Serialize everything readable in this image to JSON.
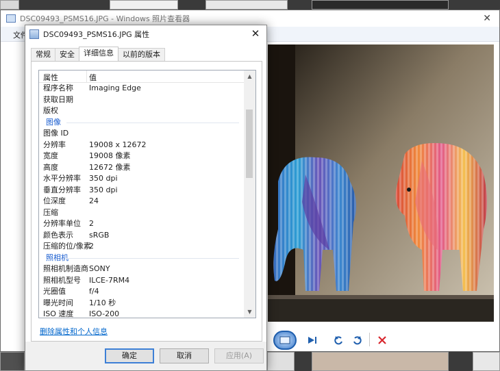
{
  "viewer": {
    "title": "DSC09493_PSMS16.JPG - Windows 照片查看器",
    "menu_file": "文件",
    "close_glyph": "✕"
  },
  "dialog": {
    "title": "DSC09493_PSMS16.JPG 属性",
    "close_glyph": "✕",
    "tabs": [
      {
        "label": "常规",
        "active": false
      },
      {
        "label": "安全",
        "active": false
      },
      {
        "label": "详细信息",
        "active": true
      },
      {
        "label": "以前的版本",
        "active": false
      }
    ],
    "list": {
      "col_name": "属性",
      "col_value": "值",
      "rows": [
        {
          "type": "row",
          "key": "程序名称",
          "value": "Imaging Edge"
        },
        {
          "type": "row",
          "key": "获取日期",
          "value": ""
        },
        {
          "type": "row",
          "key": "版权",
          "value": ""
        },
        {
          "type": "section",
          "label": "图像"
        },
        {
          "type": "row",
          "key": "图像 ID",
          "value": ""
        },
        {
          "type": "row",
          "key": "分辨率",
          "value": "19008 x 12672"
        },
        {
          "type": "row",
          "key": "宽度",
          "value": "19008 像素"
        },
        {
          "type": "row",
          "key": "高度",
          "value": "12672 像素"
        },
        {
          "type": "row",
          "key": "水平分辨率",
          "value": "350 dpi"
        },
        {
          "type": "row",
          "key": "垂直分辨率",
          "value": "350 dpi"
        },
        {
          "type": "row",
          "key": "位深度",
          "value": "24"
        },
        {
          "type": "row",
          "key": "压缩",
          "value": ""
        },
        {
          "type": "row",
          "key": "分辨率单位",
          "value": "2"
        },
        {
          "type": "row",
          "key": "颜色表示",
          "value": "sRGB"
        },
        {
          "type": "row",
          "key": "压缩的位/像素",
          "value": "2"
        },
        {
          "type": "section",
          "label": "照相机"
        },
        {
          "type": "row",
          "key": "照相机制造商",
          "value": "SONY"
        },
        {
          "type": "row",
          "key": "照相机型号",
          "value": "ILCE-7RM4"
        },
        {
          "type": "row",
          "key": "光圈值",
          "value": "f/4"
        },
        {
          "type": "row",
          "key": "曝光时间",
          "value": "1/10 秒"
        },
        {
          "type": "row",
          "key": "ISO 速度",
          "value": "ISO-200"
        }
      ]
    },
    "remove_link": "删除属性和个人信息",
    "buttons": {
      "ok": "确定",
      "cancel": "取消",
      "apply": "应用(A)"
    }
  },
  "colors": {
    "link": "#0066cc",
    "section_label": "#1c5fd0",
    "default_button_border": "#3c7fd6"
  },
  "icons": [
    "file-icon",
    "app-icon",
    "close-icon",
    "slideshow-icon",
    "next-icon",
    "rotate-left-icon",
    "rotate-right-icon",
    "delete-icon"
  ]
}
